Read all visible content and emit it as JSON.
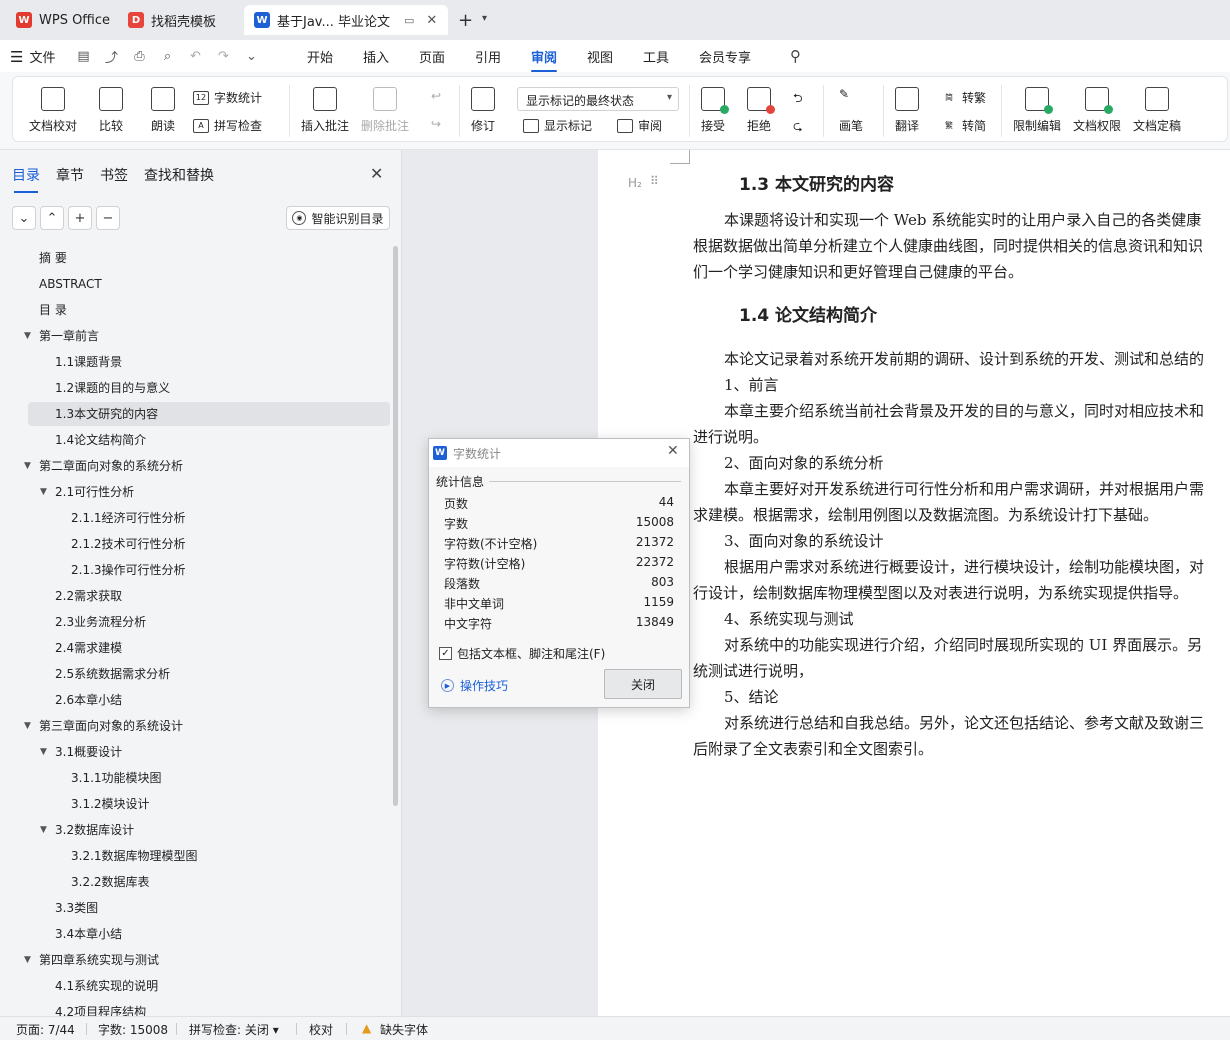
{
  "tabs": [
    {
      "label": "WPS Office",
      "icon": "wps-logo-icon",
      "color": "#e23b2e"
    },
    {
      "label": "找稻壳模板",
      "icon": "docer-icon",
      "color": "#e8453c"
    },
    {
      "label": "基于Jav... 毕业论文",
      "icon": "word-doc-icon",
      "color": "#1e5fd6",
      "active": true
    }
  ],
  "menu": {
    "file_label": "文件",
    "tabs": [
      "开始",
      "插入",
      "页面",
      "引用",
      "审阅",
      "视图",
      "工具",
      "会员专享"
    ],
    "active_tab": "审阅"
  },
  "ribbon": {
    "doc_check": "文档校对",
    "compare": "比较",
    "read_aloud": "朗读",
    "word_count": "字数统计",
    "spell_check": "拼写检查",
    "insert_comment": "插入批注",
    "delete_comment": "删除批注",
    "revise": "修订",
    "markup_select": "显示标记的最终状态",
    "show_markup": "显示标记",
    "review_pane": "审阅",
    "accept": "接受",
    "reject": "拒绝",
    "pen": "画笔",
    "translate": "翻译",
    "to_traditional": "转繁",
    "to_simplified": "转简",
    "restrict_edit": "限制编辑",
    "doc_permission": "文档权限",
    "finalize": "文档定稿"
  },
  "sidebar": {
    "tabs": [
      "目录",
      "章节",
      "书签",
      "查找和替换"
    ],
    "active_tab": "目录",
    "smart_toc": "智能识别目录",
    "toc": [
      {
        "label": "摘  要",
        "level": 1
      },
      {
        "label": "ABSTRACT",
        "level": 1
      },
      {
        "label": "目  录",
        "level": 1
      },
      {
        "label": "第一章前言",
        "level": 1,
        "expanded": true
      },
      {
        "label": "1.1课题背景",
        "level": 2
      },
      {
        "label": "1.2课题的目的与意义",
        "level": 2
      },
      {
        "label": "1.3本文研究的内容",
        "level": 2,
        "selected": true
      },
      {
        "label": "1.4论文结构简介",
        "level": 2
      },
      {
        "label": "第二章面向对象的系统分析",
        "level": 1,
        "expanded": true
      },
      {
        "label": "2.1可行性分析",
        "level": 2,
        "expanded": true
      },
      {
        "label": "2.1.1经济可行性分析",
        "level": 3
      },
      {
        "label": "2.1.2技术可行性分析",
        "level": 3
      },
      {
        "label": "2.1.3操作可行性分析",
        "level": 3
      },
      {
        "label": "2.2需求获取",
        "level": 2
      },
      {
        "label": "2.3业务流程分析",
        "level": 2
      },
      {
        "label": "2.4需求建模",
        "level": 2
      },
      {
        "label": "2.5系统数据需求分析",
        "level": 2
      },
      {
        "label": "2.6本章小结",
        "level": 2
      },
      {
        "label": "第三章面向对象的系统设计",
        "level": 1,
        "expanded": true
      },
      {
        "label": "3.1概要设计",
        "level": 2,
        "expanded": true
      },
      {
        "label": "3.1.1功能模块图",
        "level": 3
      },
      {
        "label": "3.1.2模块设计",
        "level": 3
      },
      {
        "label": "3.2数据库设计",
        "level": 2,
        "expanded": true
      },
      {
        "label": "3.2.1数据库物理模型图",
        "level": 3
      },
      {
        "label": "3.2.2数据库表",
        "level": 3
      },
      {
        "label": "3.3类图",
        "level": 2
      },
      {
        "label": "3.4本章小结",
        "level": 2
      },
      {
        "label": "第四章系统实现与测试",
        "level": 1,
        "expanded": true
      },
      {
        "label": "4.1系统实现的说明",
        "level": 2
      },
      {
        "label": "4.2项目程序结构",
        "level": 2
      }
    ]
  },
  "document": {
    "heading_marker": "H₂",
    "heading1": "1.3  本文研究的内容",
    "para1": [
      "本课题将设计和实现一个 Web 系统能实时的让用户录入自己的各类健康",
      "根据数据做出简单分析建立个人健康曲线图，同时提供相关的信息资讯和知识",
      "们一个学习健康知识和更好管理自己健康的平台。"
    ],
    "heading2": "1.4  论文结构简介",
    "para2": [
      {
        "text": "本论文记录着对系统开发前期的调研、设计到系统的开发、测试和总结的",
        "indent": true
      },
      {
        "text": "1、前言",
        "indent": true
      },
      {
        "text": "本章主要介绍系统当前社会背景及开发的目的与意义，同时对相应技术和",
        "indent": true
      },
      {
        "text": "进行说明。",
        "indent": false
      },
      {
        "text": "2、面向对象的系统分析",
        "indent": true
      },
      {
        "text": "本章主要好对开发系统进行可行性分析和用户需求调研，并对根据用户需",
        "indent": true
      },
      {
        "text": "求建模。根据需求，绘制用例图以及数据流图。为系统设计打下基础。",
        "indent": false
      },
      {
        "text": "3、面向对象的系统设计",
        "indent": true
      },
      {
        "text": "根据用户需求对系统进行概要设计，进行模块设计，绘制功能模块图，对",
        "indent": true
      },
      {
        "text": "行设计，绘制数据库物理模型图以及对表进行说明，为系统实现提供指导。",
        "indent": false
      },
      {
        "text": "4、系统实现与测试",
        "indent": true
      },
      {
        "text": "对系统中的功能实现进行介绍，介绍同时展现所实现的 UI 界面展示。另",
        "indent": true
      },
      {
        "text": "统测试进行说明，",
        "indent": false
      },
      {
        "text": "5、结论",
        "indent": true
      },
      {
        "text": "对系统进行总结和自我总结。另外，论文还包括结论、参考文献及致谢三",
        "indent": true
      },
      {
        "text": "后附录了全文表索引和全文图索引。",
        "indent": false
      }
    ]
  },
  "dialog": {
    "title": "字数统计",
    "section": "统计信息",
    "stats": [
      {
        "label": "页数",
        "value": "44"
      },
      {
        "label": "字数",
        "value": "15008"
      },
      {
        "label": "字符数(不计空格)",
        "value": "21372"
      },
      {
        "label": "字符数(计空格)",
        "value": "22372"
      },
      {
        "label": "段落数",
        "value": "803"
      },
      {
        "label": "非中文单词",
        "value": "1159"
      },
      {
        "label": "中文字符",
        "value": "13849"
      }
    ],
    "checkbox_label": "包括文本框、脚注和尾注(F)",
    "checkbox_checked": true,
    "tips_link": "操作技巧",
    "close_button": "关闭"
  },
  "status": {
    "page": "页面: 7/44",
    "words": "字数: 15008",
    "spell": "拼写检查: 关闭",
    "proof": "校对",
    "missing_font": "缺失字体"
  },
  "colors": {
    "accent": "#1a5fd8",
    "warning": "#e59b1a"
  }
}
